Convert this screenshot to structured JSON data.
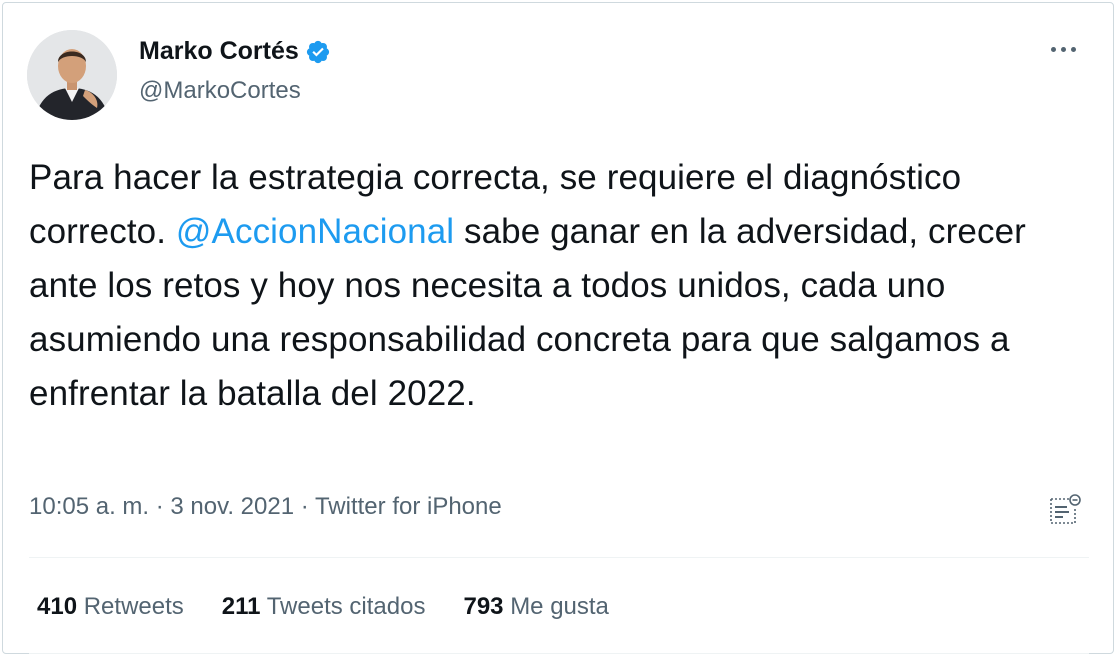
{
  "author": {
    "name": "Marko Cortés",
    "handle": "@MarkoCortes",
    "avatar_icon": "profile-photo",
    "verified_icon": "verified-badge-icon"
  },
  "tweet": {
    "text_before": "Para hacer la estrategia correcta, se requiere el diagnóstico correcto. ",
    "mention": "@AccionNacional",
    "text_after": " sabe ganar en la adversidad, crecer ante los retos y hoy nos necesita a todos unidos, cada uno asumiendo una responsabilidad concreta para que salgamos a enfrentar la batalla del 2022."
  },
  "meta": {
    "time": "10:05 a. m.",
    "sep1": " · ",
    "date": "3 nov. 2021",
    "sep2": " · ",
    "source": "Twitter for iPhone"
  },
  "stats": {
    "retweets_count": "410",
    "retweets_label": "Retweets",
    "quotes_count": "211",
    "quotes_label": "Tweets citados",
    "likes_count": "793",
    "likes_label": "Me gusta"
  },
  "colors": {
    "accent": "#1d9bf0",
    "text": "#0f1419",
    "secondary": "#536471"
  }
}
